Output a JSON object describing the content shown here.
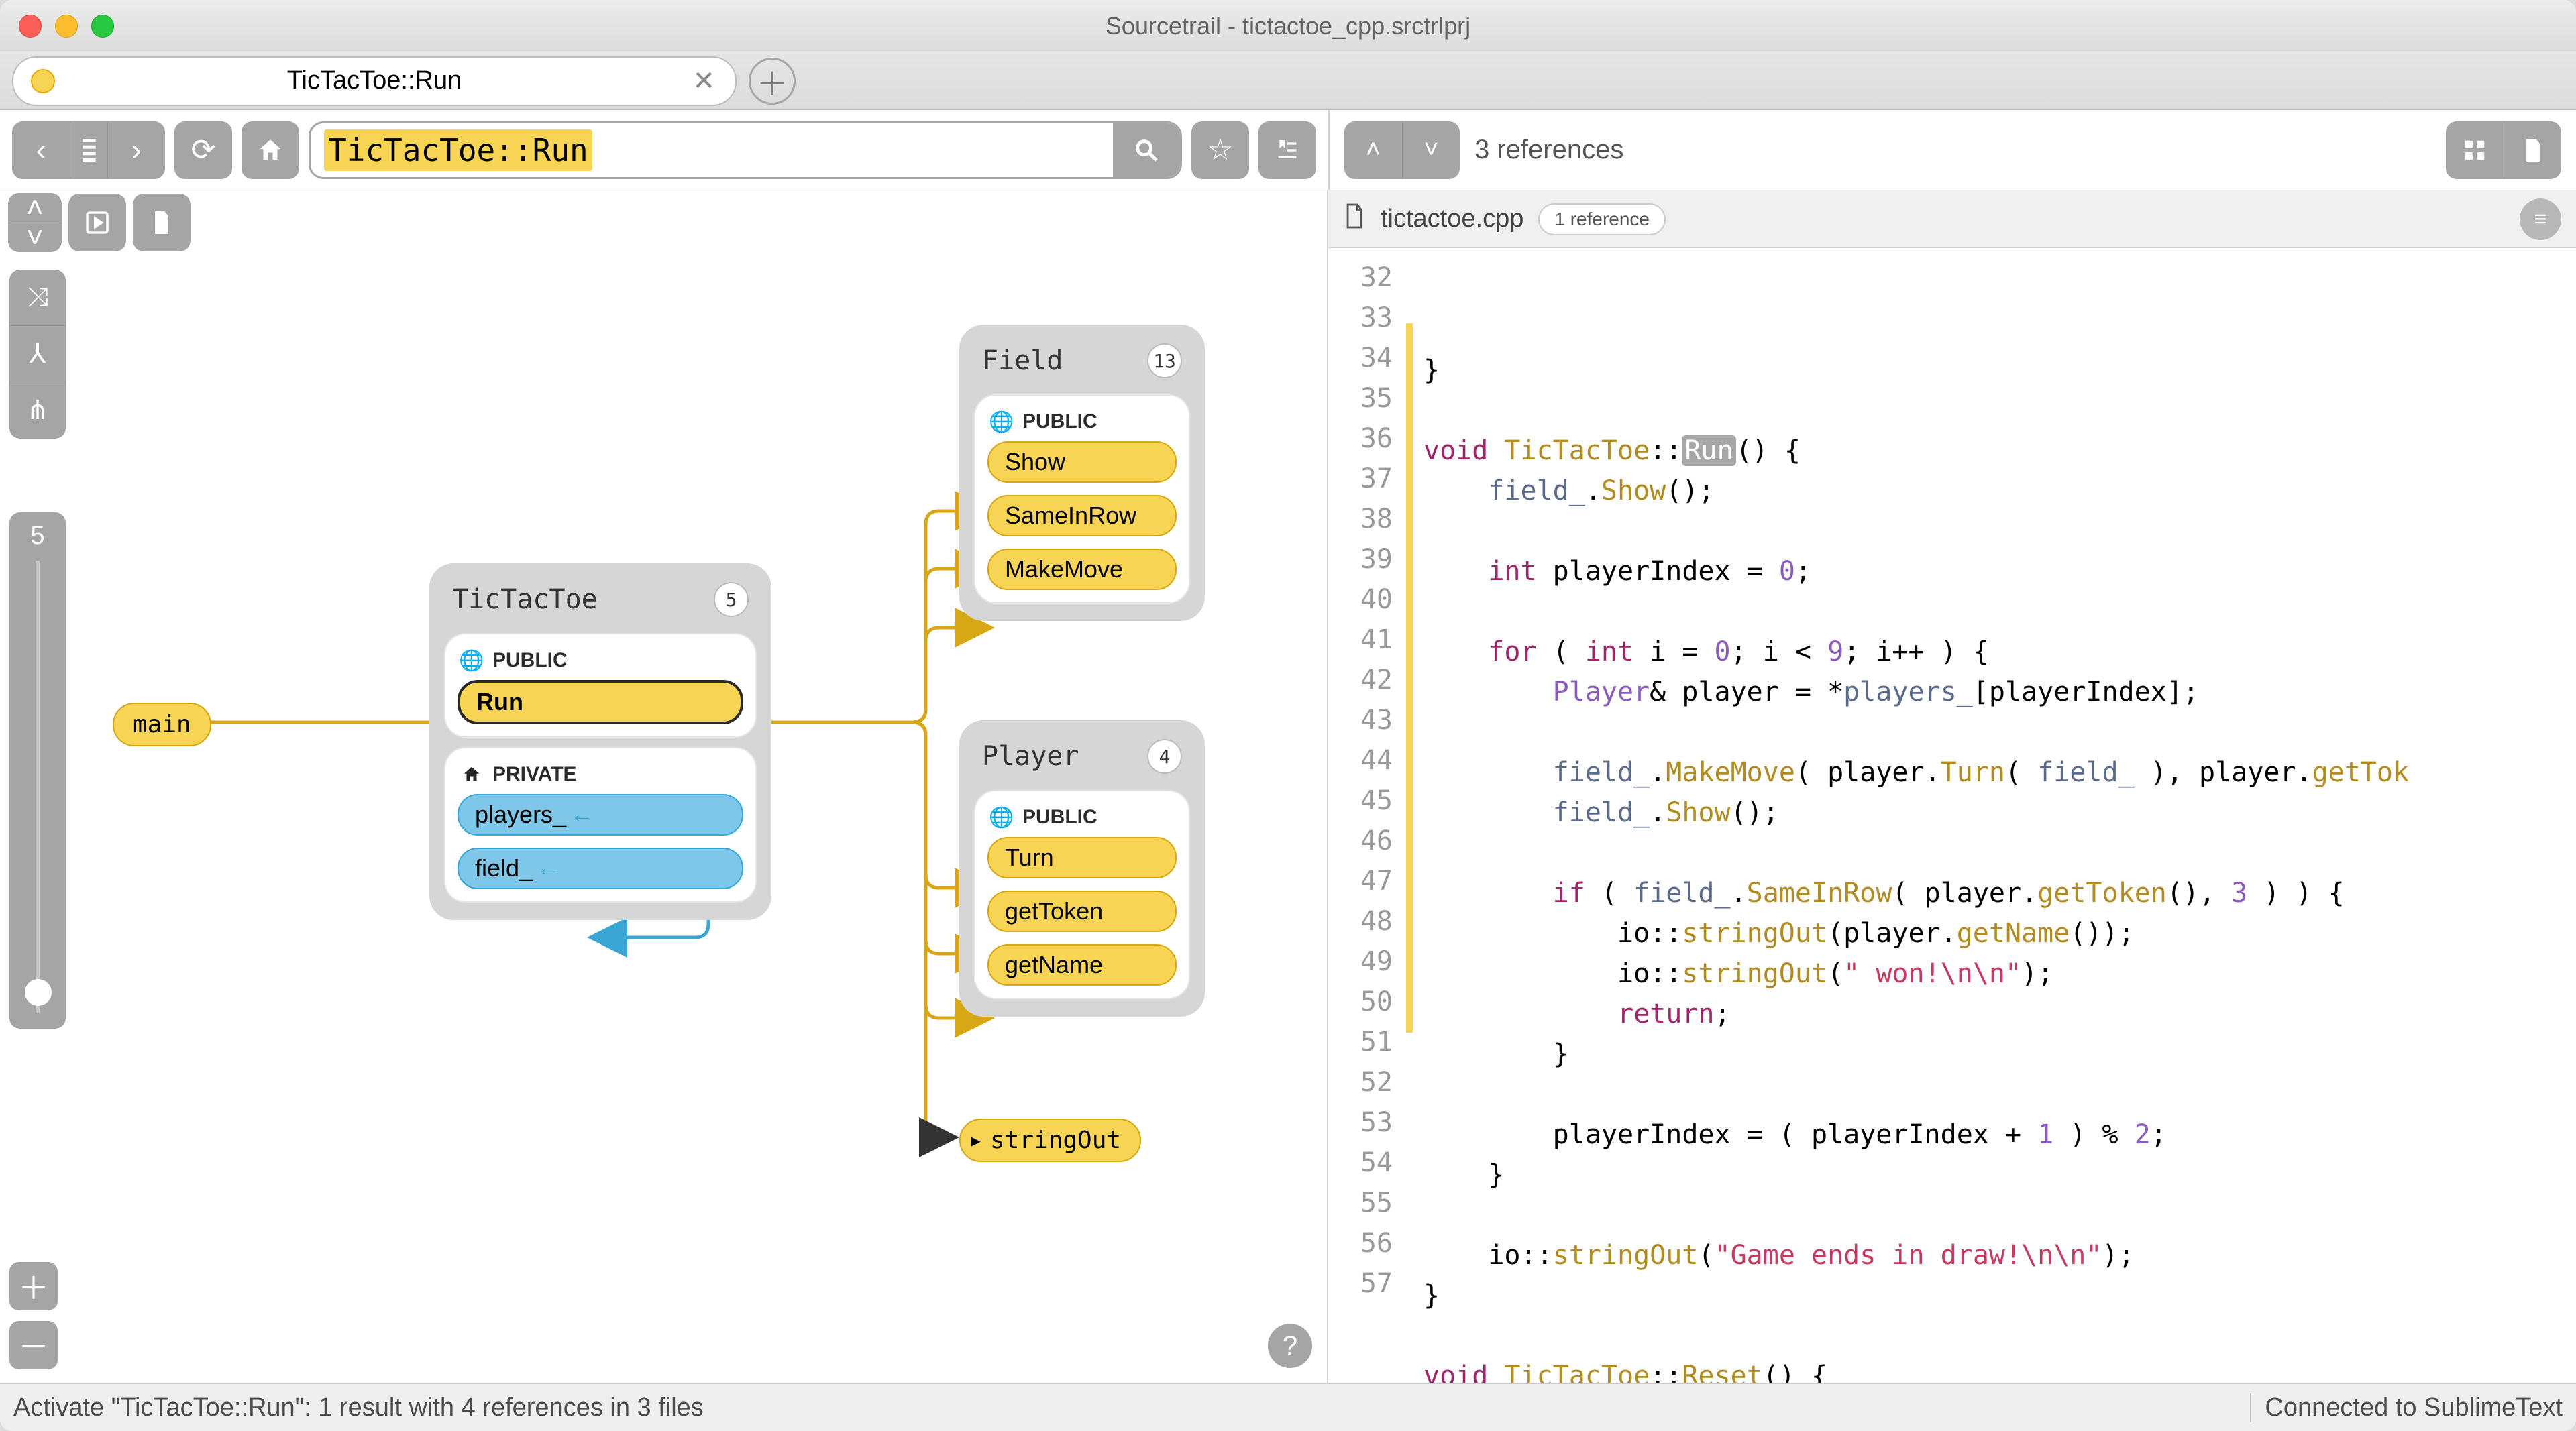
{
  "app": {
    "title": "Sourcetrail - tictactoe_cpp.srctrlprj"
  },
  "tab": {
    "label": "TicTacToe::Run"
  },
  "search": {
    "query": "TicTacToe::Run"
  },
  "code": {
    "references_header": "3 references",
    "filename": "tictactoe.cpp",
    "file_refs": "1 reference",
    "first_line": 32,
    "lines": [
      {
        "n": 32,
        "html": "}"
      },
      {
        "n": 33,
        "html": ""
      },
      {
        "n": 34,
        "html": "<span class='kw'>void</span> <span class='cls'>TicTacToe</span>::<span class='sel'>Run</span>() {",
        "hl": true
      },
      {
        "n": 35,
        "html": "    <span class='mem'>field_</span>.<span class='fn'>Show</span>();",
        "hl": true
      },
      {
        "n": 36,
        "html": "",
        "hl": true
      },
      {
        "n": 37,
        "html": "    <span class='kw'>int</span> playerIndex = <span class='nm'>0</span>;",
        "hl": true
      },
      {
        "n": 38,
        "html": "",
        "hl": true
      },
      {
        "n": 39,
        "html": "    <span class='kw'>for</span> ( <span class='kw'>int</span> i = <span class='nm'>0</span>; i &lt; <span class='nm'>9</span>; i++ ) {",
        "hl": true
      },
      {
        "n": 40,
        "html": "        <span class='ty'>Player</span>&amp; player = *<span class='mem'>players_</span>[playerIndex];",
        "hl": true
      },
      {
        "n": 41,
        "html": "",
        "hl": true
      },
      {
        "n": 42,
        "html": "        <span class='mem'>field_</span>.<span class='fn'>MakeMove</span>( player.<span class='fn'>Turn</span>( <span class='mem'>field_</span> ), player.<span class='fn'>getTok</span>",
        "hl": true
      },
      {
        "n": 43,
        "html": "        <span class='mem'>field_</span>.<span class='fn'>Show</span>();",
        "hl": true
      },
      {
        "n": 44,
        "html": "",
        "hl": true
      },
      {
        "n": 45,
        "html": "        <span class='kw'>if</span> ( <span class='mem'>field_</span>.<span class='fn'>SameInRow</span>( player.<span class='fn'>getToken</span>(), <span class='nm'>3</span> ) ) {",
        "hl": true
      },
      {
        "n": 46,
        "html": "            io::<span class='fn'>stringOut</span>(player.<span class='fn'>getName</span>());",
        "hl": true
      },
      {
        "n": 47,
        "html": "            io::<span class='fn'>stringOut</span>(<span class='str'>\" won!\\n\\n\"</span>);",
        "hl": true
      },
      {
        "n": 48,
        "html": "            <span class='kw'>return</span>;",
        "hl": true
      },
      {
        "n": 49,
        "html": "        }",
        "hl": true
      },
      {
        "n": 50,
        "html": "",
        "hl": true
      },
      {
        "n": 51,
        "html": "        playerIndex = ( playerIndex + <span class='nm'>1</span> ) % <span class='nm'>2</span>;",
        "hl": true
      },
      {
        "n": 52,
        "html": "    }",
        "hl": true
      },
      {
        "n": 53,
        "html": ""
      },
      {
        "n": 54,
        "html": "    io::<span class='fn'>stringOut</span>(<span class='str'>\"Game ends in draw!\\n\\n\"</span>);"
      },
      {
        "n": 55,
        "html": "}"
      },
      {
        "n": 56,
        "html": ""
      },
      {
        "n": 57,
        "html": "<span class='kw'>void</span> <span class='cls'>TicTacToe</span>::<span class='fn'>Reset</span>() {"
      }
    ]
  },
  "graph": {
    "depth_max": "5",
    "main_node": "main",
    "tictactoe": {
      "title": "TicTacToe",
      "badge": "5",
      "public": "PUBLIC",
      "private": "PRIVATE",
      "run": "Run",
      "players": "players_",
      "field": "field_"
    },
    "field": {
      "title": "Field",
      "badge": "13",
      "public": "PUBLIC",
      "show": "Show",
      "sameinrow": "SameInRow",
      "makemove": "MakeMove"
    },
    "player": {
      "title": "Player",
      "badge": "4",
      "public": "PUBLIC",
      "turn": "Turn",
      "gettoken": "getToken",
      "getname": "getName"
    },
    "stringout": "stringOut"
  },
  "status": {
    "left": "Activate \"TicTacToe::Run\": 1 result with 4 references in 3 files",
    "right": "Connected to SublimeText"
  }
}
